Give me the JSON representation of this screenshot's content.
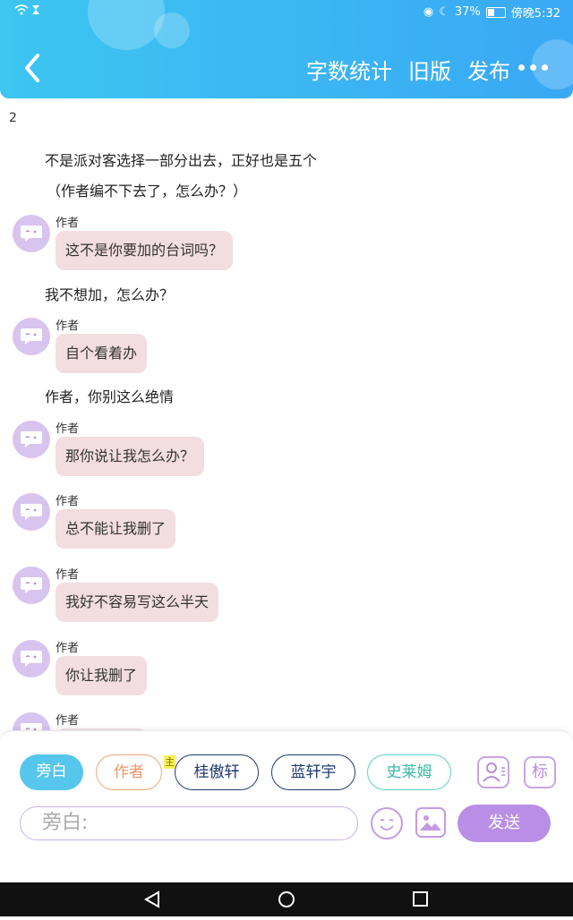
{
  "status_bar": {
    "battery": "37%",
    "time": "傍晚5:32",
    "battery_level": 0.37
  },
  "header": {
    "word_count": "字数统计",
    "old_version": "旧版",
    "publish": "发布"
  },
  "content": {
    "chapter_number": "2",
    "narration_1": "不是派对客选择一部分出去，正好也是五个",
    "narration_2": "（作者编不下去了，怎么办？）",
    "narration_3": "我不想加，怎么办？",
    "narration_4": "作者，你别这么绝情",
    "messages": [
      {
        "speaker": "作者",
        "text": "这不是你要加的台词吗？"
      },
      {
        "speaker": "作者",
        "text": "自个看着办"
      },
      {
        "speaker": "作者",
        "text": "那你说让我怎么办？"
      },
      {
        "speaker": "作者",
        "text": "总不能让我删了"
      },
      {
        "speaker": "作者",
        "text": "我好不容易写这么半天"
      },
      {
        "speaker": "作者",
        "text": "你让我删了"
      },
      {
        "speaker": "作者",
        "text": ""
      }
    ]
  },
  "composer": {
    "roles": [
      "旁白",
      "作者",
      "桂傲轩",
      "蓝轩宇",
      "史莱姆"
    ],
    "main_badge": "主",
    "mark_label": "标",
    "placeholder": "旁白:",
    "send": "发送"
  },
  "colors": {
    "header": "#3ab8f2",
    "bubble": "#f2dde0",
    "accent": "#b98ee6"
  }
}
